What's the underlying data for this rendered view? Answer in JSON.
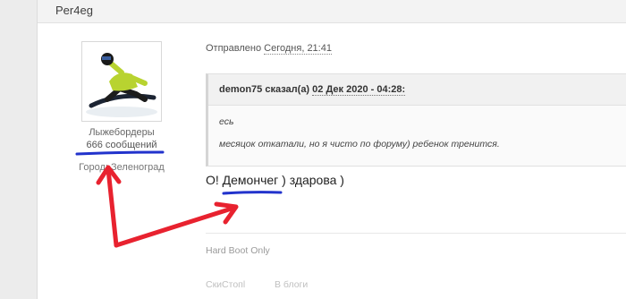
{
  "post": {
    "author": "Per4eg",
    "date_prefix": "Отправлено",
    "date_time": "Сегодня, 21:41",
    "reply": "О! Демончег ) здарова )",
    "signature": "Hard Boot Only"
  },
  "profile": {
    "group": "Лыжебордеры",
    "posts_count": "666 сообщений",
    "city_label": "Город:",
    "city": "Зеленоград"
  },
  "quote": {
    "citation_author": "demon75 сказал(а)",
    "citation_date": "02 Дек 2020 - 04:28:",
    "lines": [
      "есь",
      "месяцок откатали, но я чисто по форуму) ребенок тренится."
    ]
  },
  "footer": {
    "link1": "СкиСтопl",
    "link2": "В блоги"
  },
  "colors": {
    "underline": "#2233cc",
    "arrows": "#e8222f"
  }
}
